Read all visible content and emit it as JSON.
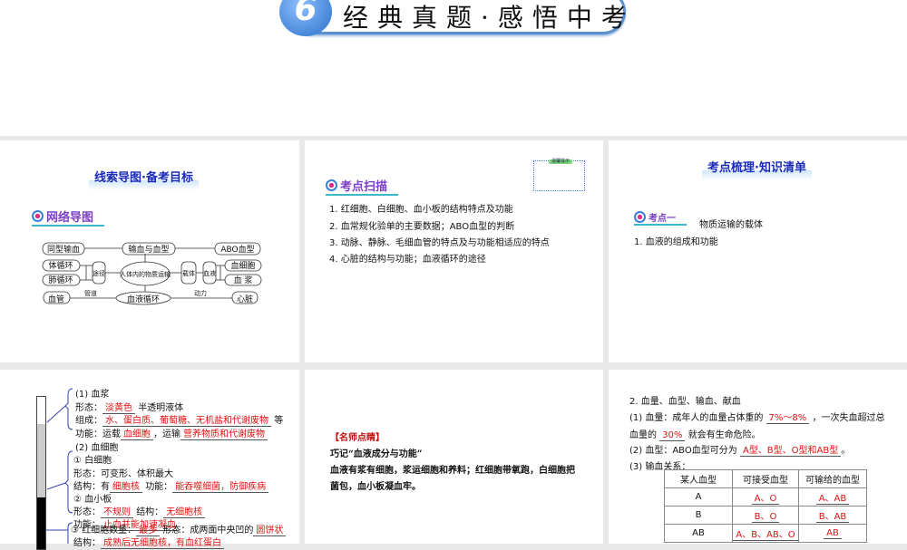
{
  "header": {
    "badge_number": "6",
    "title": "经典真题·感悟中考"
  },
  "panel1": {
    "title": "线索导图·备考目标",
    "tag": "网络导图",
    "diagram": {
      "center": "人体内的物质运输",
      "top": "输血与血型",
      "left_top": "同型输血",
      "right_top": "ABO血型",
      "route": "途径",
      "route_items": [
        "体循环",
        "肺循环"
      ],
      "carrier": "载体",
      "blood": "血液",
      "blood_items": [
        "血细胞",
        "血 浆"
      ],
      "bottom": "血液循环",
      "left_bottom": "血管",
      "right_bottom": "心脏",
      "label_left": "管道",
      "label_right": "动力"
    }
  },
  "panel2": {
    "tag": "考点扫描",
    "note_label": "温馨提示",
    "items": [
      "1. 红细胞、白细胞、血小板的结构特点及功能",
      "2. 血常规化验单的主要数据；ABO血型的判断",
      "3. 动脉、静脉、毛细血管的特点及与功能相适应的特点",
      "4. 心脏的结构与功能；血液循环的途径"
    ]
  },
  "panel3": {
    "title": "考点梳理·知识清单",
    "tag": "考点一",
    "topic": "物质运输的载体",
    "sub": "1. 血液的组成和功能"
  },
  "panel4": {
    "plasma": "(1) 血浆",
    "form_l": "形态：",
    "form_a": "淡黄色",
    "form_r": "半透明液体",
    "comp_l": "组成：",
    "comp_a": "水、蛋白质、葡萄糖、无机盐和代谢废物",
    "comp_r": "等",
    "func_l": "功能：运载",
    "func_a1": "血细胞",
    "func_m": "，运输",
    "func_a2": "营养物质和代谢废物",
    "cells": "(2) 血细胞",
    "wbc": "① 白细胞",
    "wbc_form": "形态：可变形、体积最大",
    "wbc_struct_l": "结构：有",
    "wbc_struct_a": "细胞核",
    "wbc_func_l": "功能：",
    "wbc_func_a": "能吞噬细菌，防御疾病",
    "plt": "② 血小板",
    "plt_form_l": "形态：",
    "plt_form_a": "不规则",
    "plt_struct_l": "结构：",
    "plt_struct_a": "无细胞核",
    "plt_func_l": "功能：",
    "plt_func_a": "止血并能加速凝血",
    "rbc_l": "③ 红细胞数量：",
    "rbc_a": "最多",
    "rbc_m": "形态：成两面中央凹的",
    "rbc_a2": "圆饼状",
    "rbc_struct_l": "结构：",
    "rbc_struct_a": "成熟后无细胞核，有血红蛋白"
  },
  "panel5": {
    "heading": "【名师点睛】",
    "subtitle": "巧记“血液成分与功能”",
    "body1": "血液有浆有细胞，浆运细胞和养料；红细胞带氧跑，白细胞把",
    "body2": "菌包，血小板凝血牢。"
  },
  "panel6": {
    "heading": "2. 血量、血型、输血、献血",
    "l1a": "(1) 血量：成年人的血量占体重的",
    "l1b": "7%～8%",
    "l1c": "，一次失血超过总",
    "l2a": "血量的",
    "l2b": "30%",
    "l2c": "就会有生命危险。",
    "l3a": "(2) 血型：ABO血型可分为",
    "l3b": "A型、B型、O型和AB型",
    "l3c": "。",
    "l4": "(3) 输血关系：",
    "table": {
      "headers": [
        "某人血型",
        "可接受血型",
        "可输给的血型"
      ],
      "rows": [
        [
          "A",
          "A、O",
          "A、AB"
        ],
        [
          "B",
          "B、O",
          "B、AB"
        ],
        [
          "AB",
          "A、B、AB、O",
          "AB"
        ]
      ]
    }
  }
}
